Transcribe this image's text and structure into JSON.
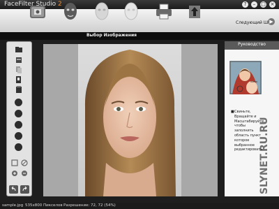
{
  "app": {
    "title_main": "FaceFilter Studio",
    "title_version": "2"
  },
  "window_controls": {
    "help": "?",
    "minimize": "–",
    "maximize": "□",
    "close": "×"
  },
  "toolbar": {
    "tools": [
      "open-photo-icon",
      "face-mask-icon",
      "face-filter-icon",
      "face-outline-icon",
      "print-icon",
      "export-icon"
    ],
    "next_step_label": "Следующий Шаг",
    "next_arrow": "▶"
  },
  "section": {
    "title": "Выбор Изображения"
  },
  "left_tools": [
    "open-file-icon",
    "rotate-icon",
    "copy-icon",
    "crop-icon",
    "paste-icon",
    "brush-icon",
    "pencil-icon",
    "eraser-icon",
    "target-icon",
    "sparkle-icon",
    "fit-icon",
    "cancel-icon",
    "zoom-in-icon",
    "zoom-out-icon",
    "undo-icon",
    "redo-icon"
  ],
  "guide": {
    "title": "Руководство",
    "bullet": "■",
    "text": "Свиньте, Вращайте и Масштабируйте, чтобы заполнить область пункт которое выбранное редактировать"
  },
  "watermark": "SLYNET.RU.RU",
  "status": {
    "filename": "sample.jpg",
    "size": "535x800 Пикселов",
    "resolution": "Разрешение: 72, 72 (54%)"
  },
  "colors": {
    "accent": "#f08a2c",
    "canvas_bg": "#a8a8a8",
    "section_bar": "#0d0d0d"
  }
}
